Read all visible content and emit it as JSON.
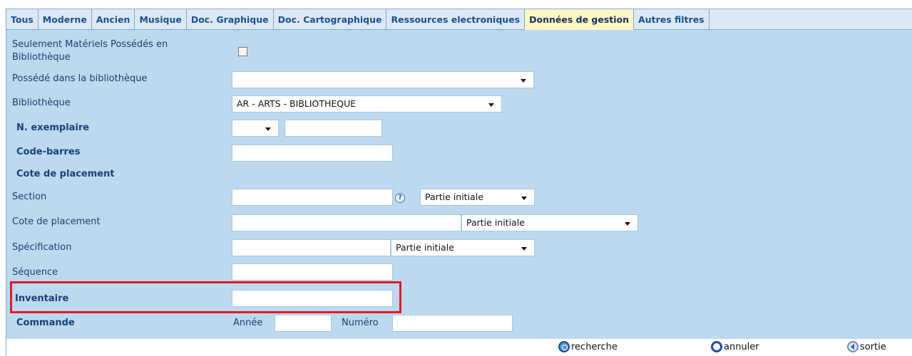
{
  "tabs": [
    {
      "label": "Tous"
    },
    {
      "label": "Moderne"
    },
    {
      "label": "Ancien"
    },
    {
      "label": "Musique"
    },
    {
      "label": "Doc. Graphique"
    },
    {
      "label": "Doc. Cartographique"
    },
    {
      "label": "Ressources electroniques"
    },
    {
      "label": "Données de gestion",
      "active": true
    },
    {
      "label": "Autres filtres"
    }
  ],
  "form": {
    "owned_only": {
      "label_line1": "Seulement Matériels Possédés en",
      "label_line2": "Bibliothèque",
      "checked": false
    },
    "owned_in_library": {
      "label": "Possédé dans la bibliothèque",
      "value": ""
    },
    "library": {
      "label": "Bibliothèque",
      "value": "AR - ARTS - BIBLIOTHEQUE"
    },
    "copy_number": {
      "label": "N. exemplaire",
      "select_value": "",
      "input_value": ""
    },
    "barcode": {
      "label": "Code-barres",
      "value": ""
    },
    "shelfmark_header": {
      "label": "Cote de placement"
    },
    "section": {
      "label": "Section",
      "value": "",
      "mode": "Partie initiale",
      "help": "?"
    },
    "shelfmark": {
      "label": "Cote de placement",
      "value": "",
      "mode": "Partie initiale"
    },
    "specification": {
      "label": "Spécification",
      "value": "",
      "mode": "Partie initiale"
    },
    "sequence": {
      "label": "Séquence",
      "value": ""
    },
    "inventory": {
      "label": "Inventaire",
      "value": ""
    },
    "order": {
      "label": "Commande",
      "year_label": "Année",
      "year_value": "",
      "number_label": "Numéro",
      "number_value": ""
    }
  },
  "footer": {
    "search_label": "recherche",
    "cancel_label": "annuler",
    "exit_label": "sortie"
  },
  "colors": {
    "panel": "#bcd9ef",
    "active_tab": "#fdf7c3",
    "highlight": "#e01b24"
  }
}
